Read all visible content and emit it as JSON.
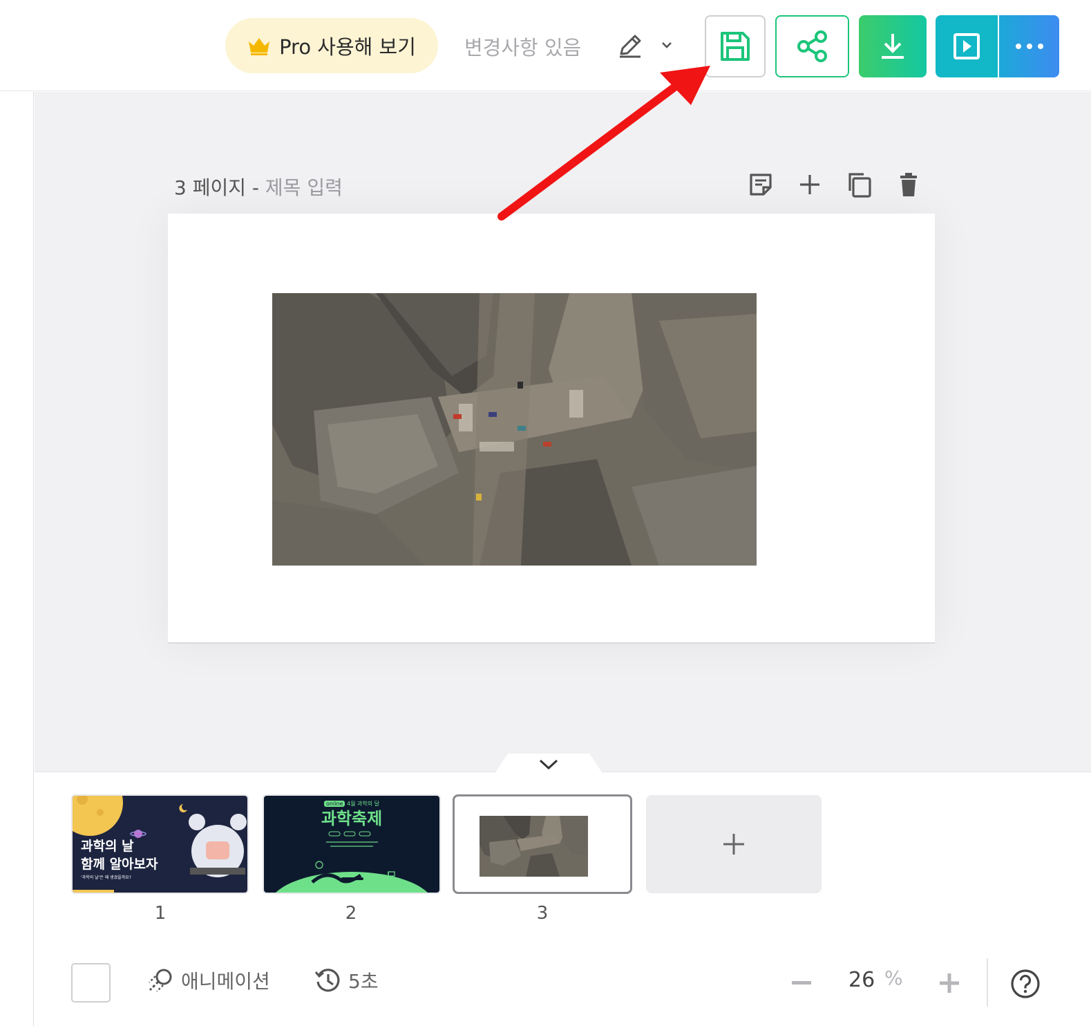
{
  "topbar": {
    "pro_button_label": "Pro 사용해 보기",
    "changes_status": "변경사항 있음",
    "icons": {
      "pro": "crown-icon",
      "edit": "pencil-icon",
      "edit_menu": "chevron-down-icon",
      "save": "save-icon",
      "share": "share-icon",
      "download": "download-icon",
      "present": "play-icon",
      "more": "more-icon"
    },
    "colors": {
      "pro_bg": "#fdf4d4",
      "crown": "#f5b800",
      "share_green": "#1cc57a",
      "download_gradient": [
        "#3ccc6b",
        "#14c7a1"
      ],
      "present": "#12b8c7",
      "more_gradient": [
        "#1da8d8",
        "#3d8cf0"
      ]
    }
  },
  "page": {
    "number_label": "3 페이지",
    "separator": "-",
    "title_placeholder": "제목 입력",
    "tools": [
      "note-icon",
      "add-icon",
      "duplicate-icon",
      "delete-icon"
    ]
  },
  "slides": [
    {
      "number": "1",
      "title_lines": [
        "과학의 날",
        "함께 알아보자"
      ],
      "subtitle": "'과학의 날'은 왜 생겼을까요?"
    },
    {
      "number": "2",
      "badge": "online",
      "kicker": "4월 과학의 달",
      "title": "과학축제"
    },
    {
      "number": "3",
      "selected": true
    }
  ],
  "bottom": {
    "animation_label": "애니메이션",
    "duration_label": "5초",
    "zoom_value": "26",
    "zoom_unit": "%",
    "icons": [
      "animation-icon",
      "history-icon",
      "zoom-out-icon",
      "zoom-in-icon",
      "help-icon"
    ]
  }
}
